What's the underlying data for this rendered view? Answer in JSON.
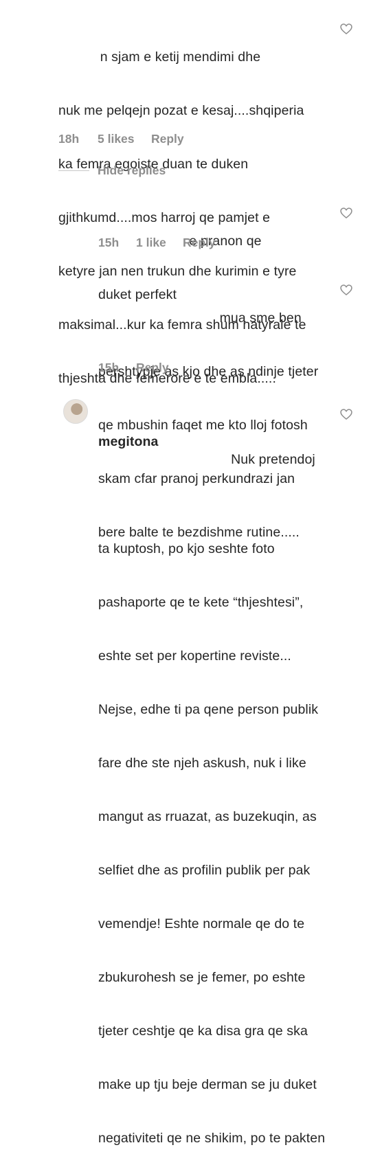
{
  "comments": [
    {
      "lines": [
        "           n sjam e ketij mendimi dhe",
        "nuk me pelqejn pozat e kesaj....shqiperia",
        "ka femra egoiste duan te duken",
        "gjithkumd....mos harroj qe pamjet e",
        "ketyre jan nen trukun dhe kurimin e tyre",
        "maksimal...kur ka femra shum natyrale te",
        "thjeshta dhe femerore e te embla....."
      ],
      "time": "18h",
      "likes": "5 likes",
      "reply": "Reply"
    },
    {
      "lines": [
        "                        e pranon qe",
        "duket perfekt"
      ],
      "time": "15h",
      "likes": "1 like",
      "reply": "Reply"
    },
    {
      "lines": [
        "                                mua sme ben",
        "pershtypje as kjo dhe as ndinje tjeter",
        "qe mbushin faqet me kto lloj fotosh",
        "skam cfar pranoj perkundrazi jan",
        "bere balte te bezdishme rutine....."
      ],
      "time": "15h",
      "reply": "Reply"
    },
    {
      "username": "megitona",
      "lines": [
        "                               Nuk pretendoj",
        "ta kuptosh, po kjo seshte foto",
        "pashaporte qe te kete “thjeshtesi”,",
        "eshte set per kopertine reviste...",
        "Nejse, edhe ti pa qene person publik",
        "fare dhe ste njeh askush, nuk i like",
        "mangut as rruazat, as buzekuqin, as",
        "selfiet dhe as profilin publik per pak",
        "vemendje! Eshte normale qe do te",
        "zbukurohesh se je femer, po eshte",
        "tjeter ceshtje qe ka disa gra qe ska",
        "make up tju beje derman se ju duket",
        "negativiteti qe ne shikim, po te pakten"
      ]
    }
  ],
  "hide_replies": "Hide replies"
}
